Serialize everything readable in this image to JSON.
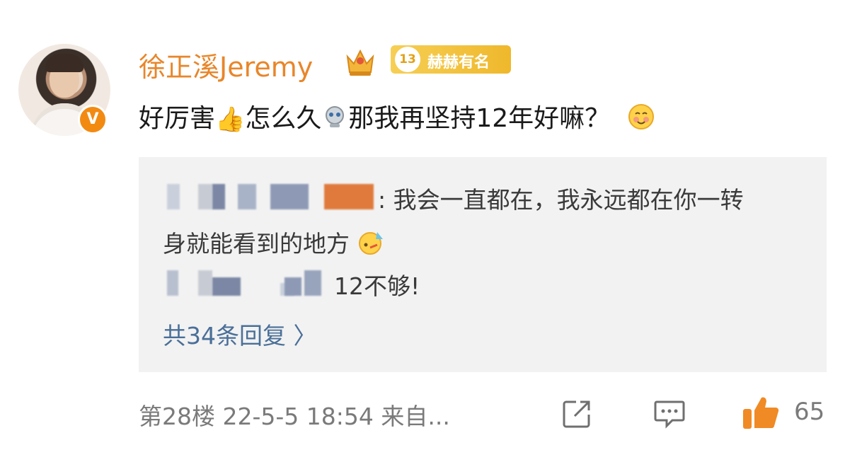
{
  "comment": {
    "username": "徐正溪Jeremy",
    "level_number": "13",
    "level_title": "赫赫有名",
    "verified_mark": "V",
    "text_part1": "好厉害",
    "text_part2": "怎么久",
    "text_part3": "那我再坚持12年好嘛？",
    "emoji_1": "thumbs-up-icon",
    "emoji_2": "robot-icon",
    "emoji_3": "blush-face-icon"
  },
  "replies": {
    "items": [
      {
        "author_blurred": true,
        "text": ": 我会一直都在，我永远都在你一转"
      },
      {
        "author_blurred": false,
        "text": "身就能看到的地方"
      },
      {
        "author_blurred": true,
        "text": "12不够!"
      }
    ],
    "more_label": "共34条回复 〉"
  },
  "footer": {
    "meta": "第28楼 22-5-5 18:54 来自...",
    "like_count": "65"
  },
  "colors": {
    "username": "#e8862a",
    "link": "#4a6f98",
    "panel": "#f2f2f2",
    "like": "#f08a24"
  }
}
